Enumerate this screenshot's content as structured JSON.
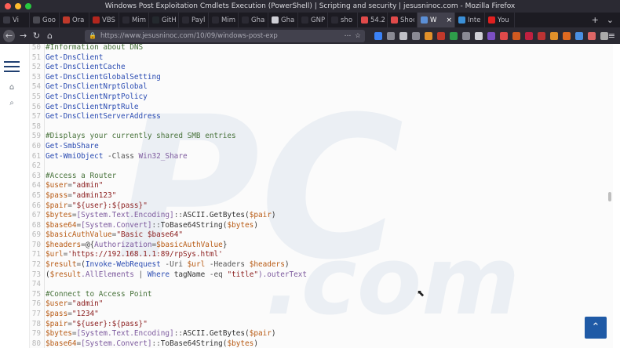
{
  "window": {
    "title": "Windows Post Exploitation Cmdlets Execution (PowerShell) | Scripting and security | jesusninoc.com - Mozilla Firefox"
  },
  "tabs": [
    {
      "label": "Vi",
      "favicon_color": "#3a3a44"
    },
    {
      "label": "Goo",
      "favicon_color": "#4a4a52"
    },
    {
      "label": "Ora",
      "favicon_color": "#c0392b"
    },
    {
      "label": "VBS",
      "favicon_color": "#b3261e"
    },
    {
      "label": "Mimikat",
      "favicon_color": "#2b2a33"
    },
    {
      "label": "GitH",
      "favicon_color": "#24292e"
    },
    {
      "label": "Payl",
      "favicon_color": "#2b2a33"
    },
    {
      "label": "Mimikat",
      "favicon_color": "#2b2a33"
    },
    {
      "label": "Ghana N",
      "favicon_color": "#2b2a33"
    },
    {
      "label": "Gha",
      "favicon_color": "#cfcfd6"
    },
    {
      "label": "GNP",
      "favicon_color": "#2b2a33"
    },
    {
      "label": "sho",
      "favicon_color": "#2b2a33"
    },
    {
      "label": "54.2",
      "favicon_color": "#e04a4a"
    },
    {
      "label": "Shoc",
      "favicon_color": "#e04a4a"
    },
    {
      "label": "W",
      "favicon_color": "#5b8fd6",
      "active": true
    },
    {
      "label": "Inte",
      "favicon_color": "#3b8fd6"
    },
    {
      "label": "You",
      "favicon_color": "#e02020"
    }
  ],
  "toolbar": {
    "back_icon": "←",
    "forward_icon": "→",
    "reload_icon": "↻",
    "home_icon": "⌂",
    "url": "https://www.jesusninoc.com/10/09/windows-post-exp",
    "menu_icon": "≡",
    "new_tab_icon": "+",
    "tab_list_icon": "⌄"
  },
  "extension_colors": [
    "#3b82f6",
    "#8a8a94",
    "#bfbfc6",
    "#8a8a94",
    "#e0902a",
    "#c0392b",
    "#2e9e4a",
    "#8a8a94",
    "#d0d0d6",
    "#7b4fc2",
    "#e04a4a",
    "#d05a20",
    "#c02040",
    "#b33",
    "#e0902a",
    "#e06a20",
    "#4a90e2",
    "#d66",
    "#aaa"
  ],
  "sidebar": {
    "home_icon": "⌂",
    "search_icon": "⌕"
  },
  "code": {
    "lines": [
      {
        "n": "50",
        "tokens": [
          {
            "t": "#Information about DNS",
            "c": "cm"
          }
        ]
      },
      {
        "n": "51",
        "tokens": [
          {
            "t": "Get-DnsClient",
            "c": "cmd"
          }
        ]
      },
      {
        "n": "52",
        "tokens": [
          {
            "t": "Get-DnsClientCache",
            "c": "cmd"
          }
        ]
      },
      {
        "n": "53",
        "tokens": [
          {
            "t": "Get-DnsClientGlobalSetting",
            "c": "cmd"
          }
        ]
      },
      {
        "n": "54",
        "tokens": [
          {
            "t": "Get-DnsClientNrptGlobal",
            "c": "cmd"
          }
        ]
      },
      {
        "n": "55",
        "tokens": [
          {
            "t": "Get-DnsClientNrptPolicy",
            "c": "cmd"
          }
        ]
      },
      {
        "n": "56",
        "tokens": [
          {
            "t": "Get-DnsClientNrptRule",
            "c": "cmd"
          }
        ]
      },
      {
        "n": "57",
        "tokens": [
          {
            "t": "Get-DnsClientServerAddress",
            "c": "cmd"
          }
        ]
      },
      {
        "n": "58",
        "tokens": []
      },
      {
        "n": "59",
        "tokens": [
          {
            "t": "#Displays your currently shared SMB entries",
            "c": "cm"
          }
        ]
      },
      {
        "n": "60",
        "tokens": [
          {
            "t": "Get-SmbShare",
            "c": "cmd"
          }
        ]
      },
      {
        "n": "61",
        "tokens": [
          {
            "t": "Get-WmiObject",
            "c": "cmd"
          },
          {
            "t": " -Class ",
            "c": "op"
          },
          {
            "t": "Win32_Share",
            "c": "typ"
          }
        ]
      },
      {
        "n": "62",
        "tokens": []
      },
      {
        "n": "63",
        "tokens": [
          {
            "t": "#Access a Router",
            "c": "cm"
          }
        ]
      },
      {
        "n": "64",
        "tokens": [
          {
            "t": "$user",
            "c": "var"
          },
          {
            "t": "=",
            "c": "op"
          },
          {
            "t": "\"admin\"",
            "c": "str"
          }
        ]
      },
      {
        "n": "65",
        "tokens": [
          {
            "t": "$pass",
            "c": "var"
          },
          {
            "t": "=",
            "c": "op"
          },
          {
            "t": "\"admin123\"",
            "c": "str"
          }
        ]
      },
      {
        "n": "66",
        "tokens": [
          {
            "t": "$pair",
            "c": "var"
          },
          {
            "t": "=",
            "c": "op"
          },
          {
            "t": "\"${user}:${pass}\"",
            "c": "str"
          }
        ]
      },
      {
        "n": "67",
        "tokens": [
          {
            "t": "$bytes",
            "c": "var"
          },
          {
            "t": "=",
            "c": "op"
          },
          {
            "t": "[System.Text.Encoding]",
            "c": "typ"
          },
          {
            "t": "::",
            "c": "op"
          },
          {
            "t": "ASCII.GetBytes(",
            "c": "code"
          },
          {
            "t": "$pair",
            "c": "var"
          },
          {
            "t": ")",
            "c": "code"
          }
        ]
      },
      {
        "n": "68",
        "tokens": [
          {
            "t": "$base64",
            "c": "var"
          },
          {
            "t": "=",
            "c": "op"
          },
          {
            "t": "[System.Convert]",
            "c": "typ"
          },
          {
            "t": "::",
            "c": "op"
          },
          {
            "t": "ToBase64String(",
            "c": "code"
          },
          {
            "t": "$bytes",
            "c": "var"
          },
          {
            "t": ")",
            "c": "code"
          }
        ]
      },
      {
        "n": "69",
        "tokens": [
          {
            "t": "$basicAuthValue",
            "c": "var"
          },
          {
            "t": "=",
            "c": "op"
          },
          {
            "t": "\"Basic $base64\"",
            "c": "str"
          }
        ]
      },
      {
        "n": "70",
        "tokens": [
          {
            "t": "$headers",
            "c": "var"
          },
          {
            "t": "=",
            "c": "op"
          },
          {
            "t": "@{",
            "c": "code"
          },
          {
            "t": "Authorization",
            "c": "typ"
          },
          {
            "t": "=",
            "c": "op"
          },
          {
            "t": "$basicAuthValue",
            "c": "var"
          },
          {
            "t": "}",
            "c": "code"
          }
        ]
      },
      {
        "n": "71",
        "tokens": [
          {
            "t": "$url",
            "c": "var"
          },
          {
            "t": "=",
            "c": "op"
          },
          {
            "t": "'https://192.168.1.1:89/rpSys.html'",
            "c": "str"
          }
        ]
      },
      {
        "n": "72",
        "tokens": [
          {
            "t": "$result",
            "c": "var"
          },
          {
            "t": "=",
            "c": "op"
          },
          {
            "t": "(",
            "c": "code"
          },
          {
            "t": "Invoke-WebRequest",
            "c": "cmd"
          },
          {
            "t": " -Uri ",
            "c": "op"
          },
          {
            "t": "$url",
            "c": "var"
          },
          {
            "t": " -Headers ",
            "c": "op"
          },
          {
            "t": "$headers",
            "c": "var"
          },
          {
            "t": ")",
            "c": "code"
          }
        ]
      },
      {
        "n": "73",
        "tokens": [
          {
            "t": "(",
            "c": "code"
          },
          {
            "t": "$result",
            "c": "var"
          },
          {
            "t": ".AllElements",
            "c": "typ"
          },
          {
            "t": " | ",
            "c": "op"
          },
          {
            "t": "Where",
            "c": "cmd"
          },
          {
            "t": " tagName ",
            "c": "code"
          },
          {
            "t": "-eq",
            "c": "op"
          },
          {
            "t": " \"title\"",
            "c": "str"
          },
          {
            "t": ").outerText",
            "c": "typ"
          }
        ]
      },
      {
        "n": "74",
        "tokens": []
      },
      {
        "n": "75",
        "tokens": [
          {
            "t": "#Connect to Access Point",
            "c": "cm"
          }
        ]
      },
      {
        "n": "76",
        "tokens": [
          {
            "t": "$user",
            "c": "var"
          },
          {
            "t": "=",
            "c": "op"
          },
          {
            "t": "\"admin\"",
            "c": "str"
          }
        ]
      },
      {
        "n": "77",
        "tokens": [
          {
            "t": "$pass",
            "c": "var"
          },
          {
            "t": "=",
            "c": "op"
          },
          {
            "t": "\"1234\"",
            "c": "str"
          }
        ]
      },
      {
        "n": "78",
        "tokens": [
          {
            "t": "$pair",
            "c": "var"
          },
          {
            "t": "=",
            "c": "op"
          },
          {
            "t": "\"${user}:${pass}\"",
            "c": "str"
          }
        ]
      },
      {
        "n": "79",
        "tokens": [
          {
            "t": "$bytes",
            "c": "var"
          },
          {
            "t": "=",
            "c": "op"
          },
          {
            "t": "[System.Text.Encoding]",
            "c": "typ"
          },
          {
            "t": "::",
            "c": "op"
          },
          {
            "t": "ASCII.GetBytes(",
            "c": "code"
          },
          {
            "t": "$pair",
            "c": "var"
          },
          {
            "t": ")",
            "c": "code"
          }
        ]
      },
      {
        "n": "80",
        "tokens": [
          {
            "t": "$base64",
            "c": "var"
          },
          {
            "t": "=",
            "c": "op"
          },
          {
            "t": "[System.Convert]",
            "c": "typ"
          },
          {
            "t": "::",
            "c": "op"
          },
          {
            "t": "ToBase64String(",
            "c": "code"
          },
          {
            "t": "$bytes",
            "c": "var"
          },
          {
            "t": ")",
            "c": "code"
          }
        ]
      }
    ]
  },
  "scroll_to_top": {
    "icon": "⌃"
  },
  "cursor_icon": "⬉",
  "colors": {
    "chrome_dark": "#1c1b22",
    "toolbar": "#2b2a33",
    "accent_blue": "#1f5aa6"
  }
}
